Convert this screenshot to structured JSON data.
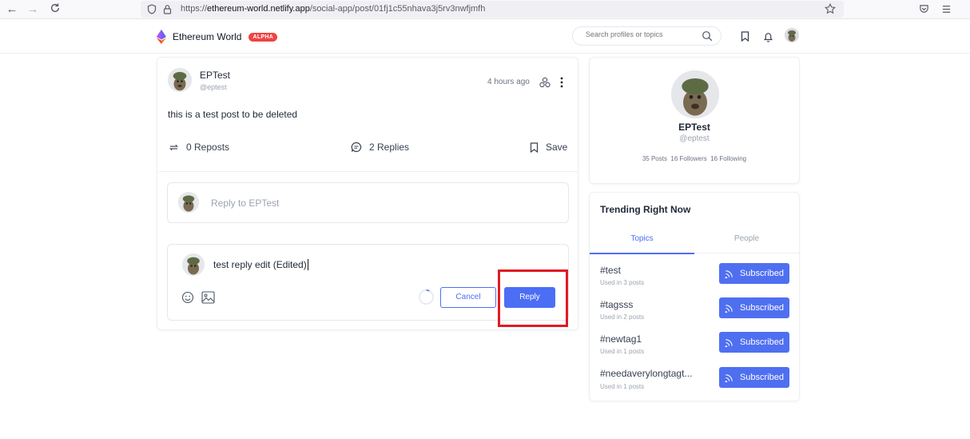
{
  "browser": {
    "url_prefix": "https://",
    "url_host": "ethereum-world.netlify.app",
    "url_path": "/social-app/post/01fj1c55nhava3j5rv3nwfjmfh"
  },
  "header": {
    "brand_name": "Ethereum World",
    "badge": "ALPHA",
    "search_placeholder": "Search profiles or topics"
  },
  "post": {
    "author_name": "EPTest",
    "author_handle": "@eptest",
    "time": "4 hours ago",
    "content": "this is a test post to be deleted",
    "reposts_label": "0 Reposts",
    "replies_label": "2 Replies",
    "save_label": "Save"
  },
  "reply_prompt": {
    "placeholder": "Reply to EPTest"
  },
  "edit_reply": {
    "text": "test reply edit (Edited)",
    "cancel_label": "Cancel",
    "reply_label": "Reply"
  },
  "profile": {
    "name": "EPTest",
    "handle": "@eptest",
    "stats": "35 Posts  16 Followers  16 Following"
  },
  "trending": {
    "title": "Trending Right Now",
    "tabs": [
      "Topics",
      "People"
    ],
    "topics": [
      {
        "name": "#test",
        "used": "Used in 3 posts",
        "button": "Subscribed"
      },
      {
        "name": "#tagsss",
        "used": "Used in 2 posts",
        "button": "Subscribed"
      },
      {
        "name": "#newtag1",
        "used": "Used in 1 posts",
        "button": "Subscribed"
      },
      {
        "name": "#needaverylongtagt...",
        "used": "Used in 1 posts",
        "button": "Subscribed"
      }
    ]
  },
  "colors": {
    "accent": "#4f6ff1",
    "alert": "#e01b24"
  }
}
